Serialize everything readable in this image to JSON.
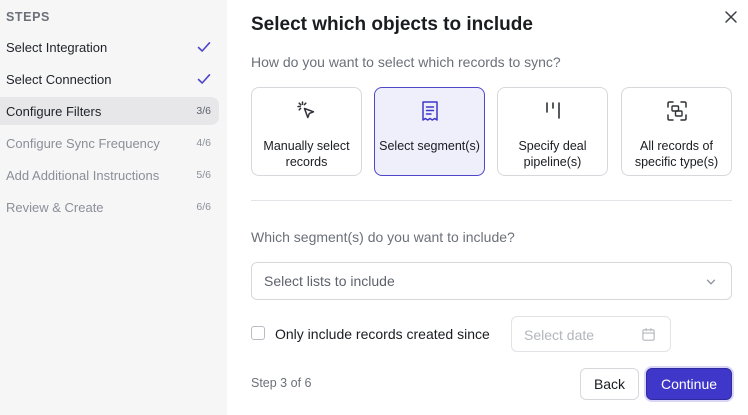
{
  "sidebar": {
    "heading": "STEPS",
    "steps": [
      {
        "label": "Select Integration",
        "status": "done",
        "icon": "check-icon"
      },
      {
        "label": "Select Connection",
        "status": "done",
        "icon": "check-icon"
      },
      {
        "label": "Configure Filters",
        "status": "active",
        "count": "3/6"
      },
      {
        "label": "Configure Sync Frequency",
        "status": "todo",
        "count": "4/6"
      },
      {
        "label": "Add Additional Instructions",
        "status": "todo",
        "count": "5/6"
      },
      {
        "label": "Review & Create",
        "status": "todo",
        "count": "6/6"
      }
    ]
  },
  "main": {
    "title": "Select which objects to include",
    "question1": "How do you want to select which records to sync?",
    "options": [
      {
        "label": "Manually select records",
        "icon": "cursor-click-icon",
        "selected": false
      },
      {
        "label": "Select segment(s)",
        "icon": "receipt-icon",
        "selected": true
      },
      {
        "label": "Specify deal pipeline(s)",
        "icon": "pipeline-icon",
        "selected": false
      },
      {
        "label": "All records of specific type(s)",
        "icon": "scan-objects-icon",
        "selected": false
      }
    ],
    "question2": "Which segment(s) do you want to include?",
    "select_placeholder": "Select lists to include",
    "checkbox_label": "Only include records created since",
    "date_placeholder": "Select date",
    "step_info": "Step 3 of 6",
    "back_label": "Back",
    "continue_label": "Continue"
  },
  "colors": {
    "accent": "#3f37c9",
    "selected_bg": "#efeffc",
    "sidebar_bg": "#f6f6f7",
    "active_step_bg": "#e7e7ea"
  }
}
